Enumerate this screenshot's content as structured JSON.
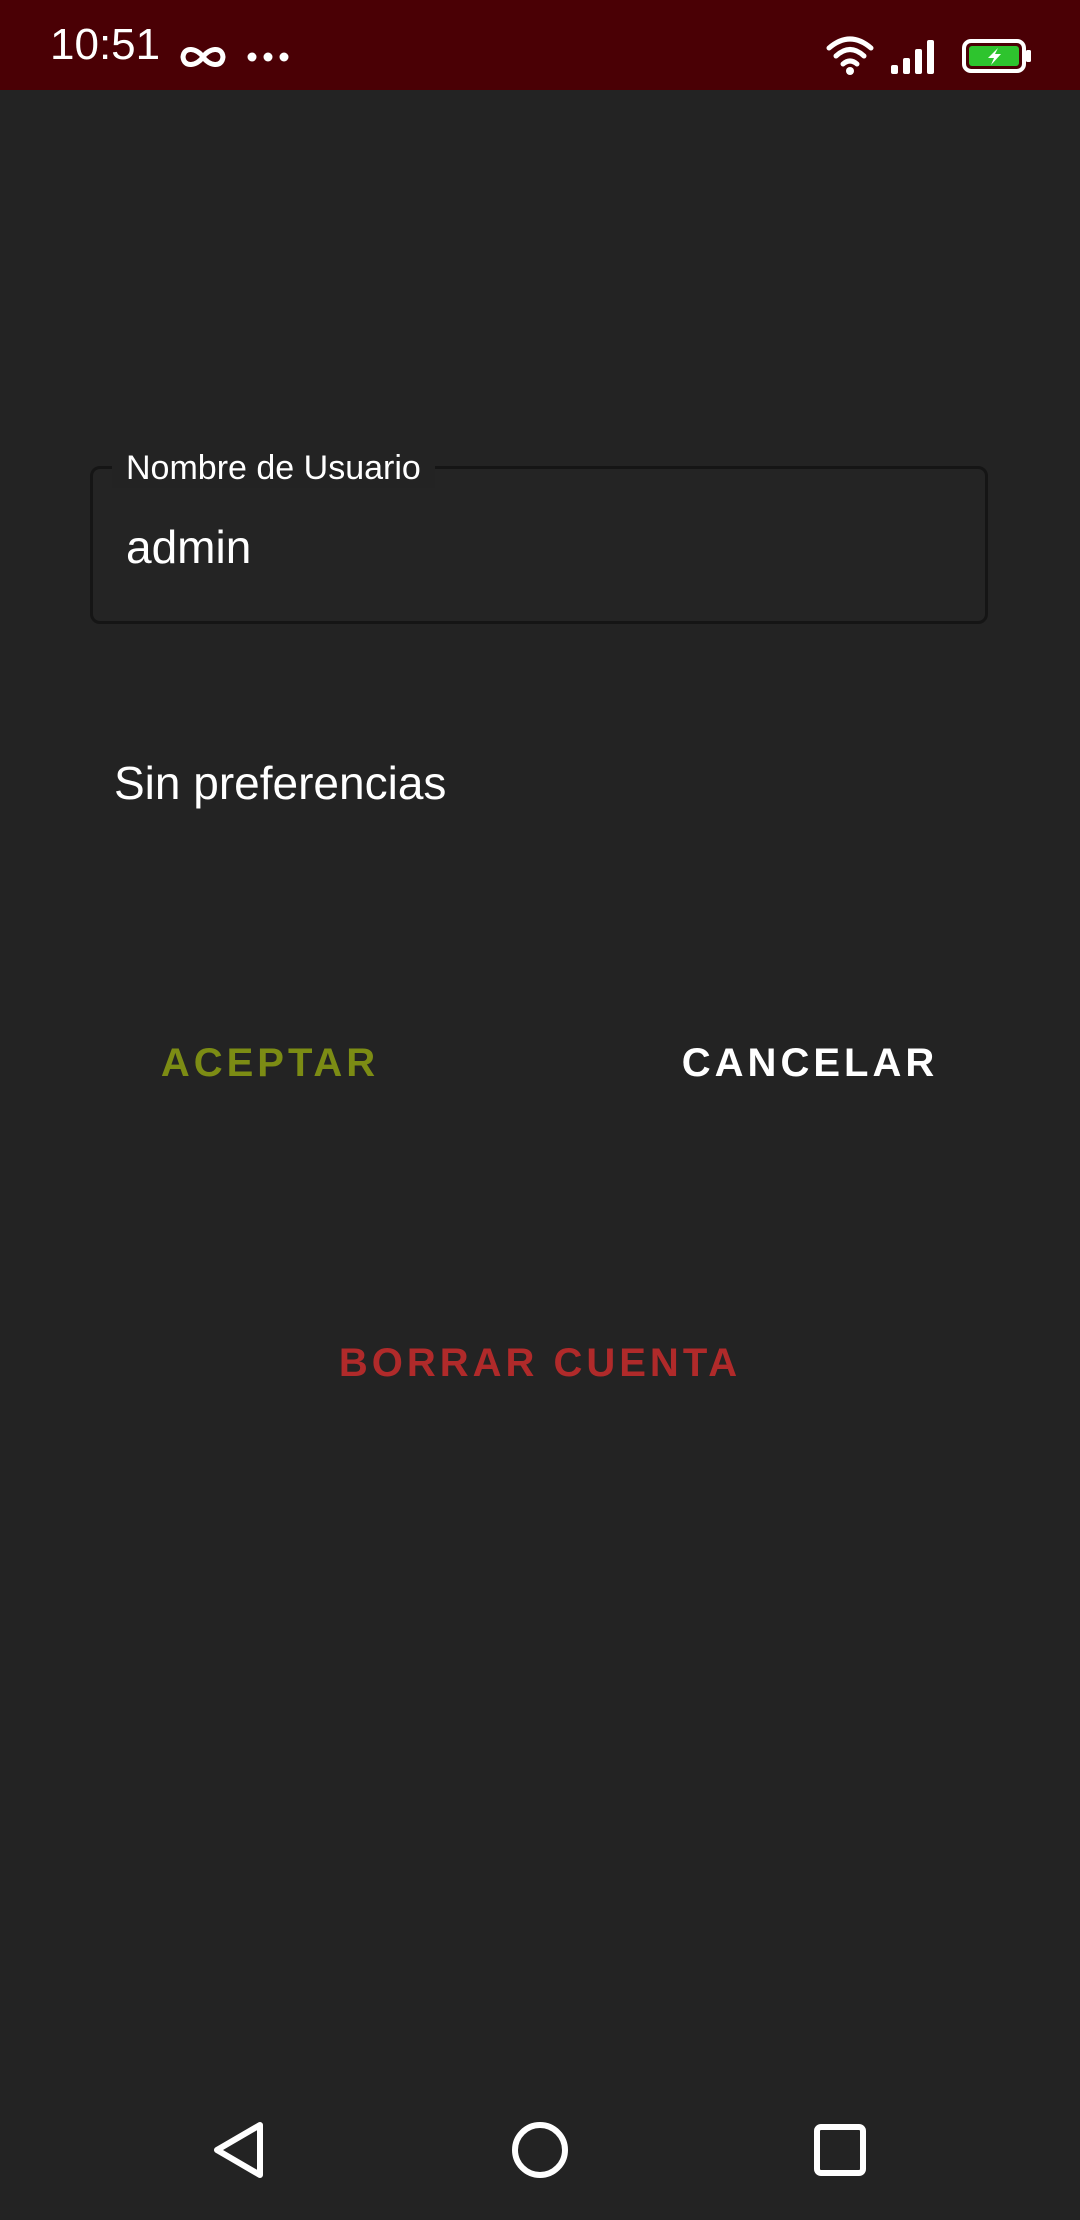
{
  "status_bar": {
    "time": "10:51",
    "background": "#4a0005",
    "icons": [
      "infinity-icon",
      "more-dots-icon",
      "wifi-icon",
      "cell-signal-icon",
      "battery-charging-icon"
    ],
    "battery_color": "#2ec42e"
  },
  "form": {
    "username_label": "Nombre de Usuario",
    "username_value": "admin",
    "preferences_text": "Sin preferencias"
  },
  "buttons": {
    "accept_label": "ACEPTAR",
    "cancel_label": "CANCELAR",
    "delete_account_label": "BORRAR CUENTA"
  },
  "colors": {
    "background": "#232323",
    "accept": "#7c8c14",
    "cancel": "#ffffff",
    "delete": "#b02a2a"
  },
  "nav_bar": {
    "icons": [
      "back-triangle-icon",
      "home-circle-icon",
      "recents-square-icon"
    ]
  }
}
